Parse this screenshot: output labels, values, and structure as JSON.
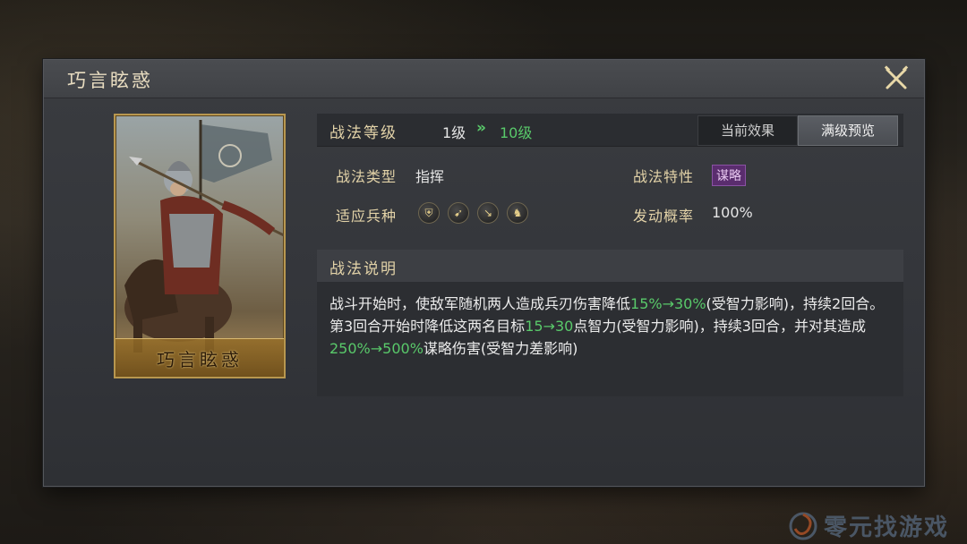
{
  "dialog": {
    "title": "巧言眩惑",
    "close_icon": "close-crossed-swords-icon"
  },
  "portrait": {
    "name": "巧言眩惑"
  },
  "level": {
    "label": "战法等级",
    "from": "1级",
    "arrow": "»",
    "to": "10级"
  },
  "tabs": [
    {
      "label": "当前效果",
      "active": false
    },
    {
      "label": "满级预览",
      "active": true
    }
  ],
  "stats": {
    "type_label": "战法类型",
    "type_value": "指挥",
    "trait_label": "战法特性",
    "trait_value": "谋略",
    "units_label": "适应兵种",
    "units": [
      "shield-icon",
      "bow-icon",
      "spear-icon",
      "horse-icon"
    ],
    "rate_label": "发动概率",
    "rate_value": "100%"
  },
  "description": {
    "title": "战法说明",
    "segments": [
      {
        "t": "战斗开始时，使敌军随机两人造成兵刃伤害降低"
      },
      {
        "t": "15%→30%",
        "hl": true
      },
      {
        "t": "(受智力影响)，持续2回合。第3回合开始时降低这两名目标"
      },
      {
        "t": "15→30",
        "hl": true
      },
      {
        "t": "点智力(受智力影响)，持续3回合，并对其造成"
      },
      {
        "t": "250%→500%",
        "hl": true
      },
      {
        "t": "谋略伤害(受智力差影响)"
      }
    ]
  },
  "colors": {
    "accent_green": "#59c96a",
    "gold_text": "#e3d3a8",
    "trait_purple": "#5a2d6e"
  },
  "watermark": {
    "text": "零元找游戏"
  }
}
